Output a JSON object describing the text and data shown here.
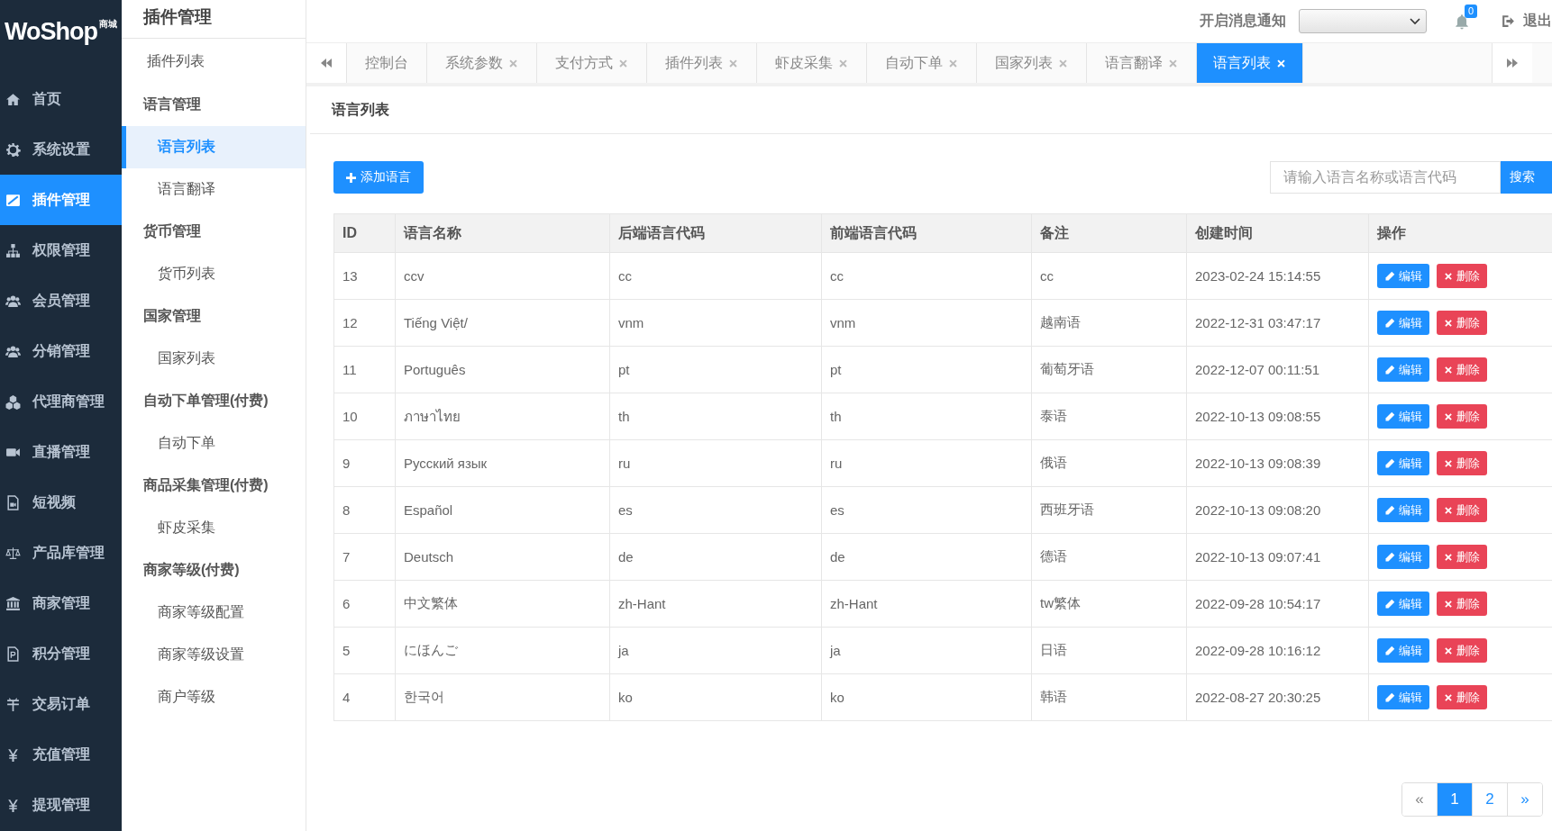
{
  "logo": {
    "text": "WoShop",
    "badge": "商城"
  },
  "nav": [
    {
      "label": "首页",
      "selected": false
    },
    {
      "label": "系统设置",
      "selected": false
    },
    {
      "label": "插件管理",
      "selected": true
    },
    {
      "label": "权限管理",
      "selected": false
    },
    {
      "label": "会员管理",
      "selected": false
    },
    {
      "label": "分销管理",
      "selected": false
    },
    {
      "label": "代理商管理",
      "selected": false
    },
    {
      "label": "直播管理",
      "selected": false
    },
    {
      "label": "短视频",
      "selected": false
    },
    {
      "label": "产品库管理",
      "selected": false
    },
    {
      "label": "商家管理",
      "selected": false
    },
    {
      "label": "积分管理",
      "selected": false
    },
    {
      "label": "交易订单",
      "selected": false
    },
    {
      "label": "充值管理",
      "selected": false
    },
    {
      "label": "提现管理",
      "selected": false
    }
  ],
  "submenu": {
    "title": "插件管理",
    "items": [
      {
        "label": "插件列表",
        "kind": "link",
        "selected": false
      },
      {
        "label": "语言管理",
        "kind": "group",
        "children": [
          {
            "label": "语言列表",
            "selected": true
          },
          {
            "label": "语言翻译",
            "selected": false
          }
        ]
      },
      {
        "label": "货币管理",
        "kind": "group",
        "children": [
          {
            "label": "货币列表",
            "selected": false
          }
        ]
      },
      {
        "label": "国家管理",
        "kind": "group",
        "children": [
          {
            "label": "国家列表",
            "selected": false
          }
        ]
      },
      {
        "label": "自动下单管理(付费)",
        "kind": "group",
        "children": [
          {
            "label": "自动下单",
            "selected": false
          }
        ]
      },
      {
        "label": "商品采集管理(付费)",
        "kind": "group",
        "children": [
          {
            "label": "虾皮采集",
            "selected": false
          }
        ]
      },
      {
        "label": "商家等级(付费)",
        "kind": "group",
        "children": [
          {
            "label": "商家等级配置",
            "selected": false
          },
          {
            "label": "商家等级设置",
            "selected": false
          },
          {
            "label": "商户等级",
            "selected": false
          }
        ]
      }
    ]
  },
  "topbar": {
    "notify_label": "开启消息通知",
    "bell_count": "0",
    "logout": "退出"
  },
  "tabs": [
    {
      "label": "控制台",
      "closable": false,
      "selected": false
    },
    {
      "label": "系统参数",
      "closable": true,
      "selected": false
    },
    {
      "label": "支付方式",
      "closable": true,
      "selected": false
    },
    {
      "label": "插件列表",
      "closable": true,
      "selected": false
    },
    {
      "label": "虾皮采集",
      "closable": true,
      "selected": false
    },
    {
      "label": "自动下单",
      "closable": true,
      "selected": false
    },
    {
      "label": "国家列表",
      "closable": true,
      "selected": false
    },
    {
      "label": "语言翻译",
      "closable": true,
      "selected": false
    },
    {
      "label": "语言列表",
      "closable": true,
      "selected": true
    }
  ],
  "panel": {
    "title": "语言列表",
    "add_button": "添加语言",
    "search": {
      "placeholder": "请输入语言名称或语言代码",
      "button": "搜索"
    }
  },
  "table": {
    "columns": [
      "ID",
      "语言名称",
      "后端语言代码",
      "前端语言代码",
      "备注",
      "创建时间",
      "操作"
    ],
    "rows": [
      {
        "cells": [
          "13",
          "ccv",
          "cc",
          "cc",
          "cc",
          "2023-02-24 15:14:55"
        ],
        "actions": [
          {
            "label": "编辑",
            "kind": "edit"
          },
          {
            "label": "删除",
            "kind": "delete"
          }
        ]
      },
      {
        "cells": [
          "12",
          "Tiếng Việt/",
          "vnm",
          "vnm",
          "越南语",
          "2022-12-31 03:47:17"
        ],
        "actions": [
          {
            "label": "编辑",
            "kind": "edit"
          },
          {
            "label": "删除",
            "kind": "delete"
          }
        ]
      },
      {
        "cells": [
          "11",
          "Português",
          "pt",
          "pt",
          "葡萄牙语",
          "2022-12-07 00:11:51"
        ],
        "actions": [
          {
            "label": "编辑",
            "kind": "edit"
          },
          {
            "label": "删除",
            "kind": "delete"
          }
        ]
      },
      {
        "cells": [
          "10",
          "ภาษาไทย",
          "th",
          "th",
          "泰语",
          "2022-10-13 09:08:55"
        ],
        "actions": [
          {
            "label": "编辑",
            "kind": "edit"
          },
          {
            "label": "删除",
            "kind": "delete"
          }
        ]
      },
      {
        "cells": [
          "9",
          "Русский язык",
          "ru",
          "ru",
          "俄语",
          "2022-10-13 09:08:39"
        ],
        "actions": [
          {
            "label": "编辑",
            "kind": "edit"
          },
          {
            "label": "删除",
            "kind": "delete"
          }
        ]
      },
      {
        "cells": [
          "8",
          "Español",
          "es",
          "es",
          "西班牙语",
          "2022-10-13 09:08:20"
        ],
        "actions": [
          {
            "label": "编辑",
            "kind": "edit"
          },
          {
            "label": "删除",
            "kind": "delete"
          }
        ]
      },
      {
        "cells": [
          "7",
          "Deutsch",
          "de",
          "de",
          "德语",
          "2022-10-13 09:07:41"
        ],
        "actions": [
          {
            "label": "编辑",
            "kind": "edit"
          },
          {
            "label": "删除",
            "kind": "delete"
          }
        ]
      },
      {
        "cells": [
          "6",
          "中文繁体",
          "zh-Hant",
          "zh-Hant",
          "tw繁体",
          "2022-09-28 10:54:17"
        ],
        "actions": [
          {
            "label": "编辑",
            "kind": "edit"
          },
          {
            "label": "删除",
            "kind": "delete"
          }
        ]
      },
      {
        "cells": [
          "5",
          "にほんご",
          "ja",
          "ja",
          "日语",
          "2022-09-28 10:16:12"
        ],
        "actions": [
          {
            "label": "编辑",
            "kind": "edit"
          },
          {
            "label": "删除",
            "kind": "delete"
          }
        ]
      },
      {
        "cells": [
          "4",
          "한국어",
          "ko",
          "ko",
          "韩语",
          "2022-08-27 20:30:25"
        ],
        "actions": [
          {
            "label": "编辑",
            "kind": "edit"
          },
          {
            "label": "删除",
            "kind": "delete"
          }
        ]
      }
    ]
  },
  "pagination": [
    {
      "label": "«",
      "kind": "prev",
      "selected": false
    },
    {
      "label": "1",
      "kind": "page",
      "selected": true
    },
    {
      "label": "2",
      "kind": "page",
      "selected": false
    },
    {
      "label": "»",
      "kind": "next",
      "selected": false
    }
  ]
}
